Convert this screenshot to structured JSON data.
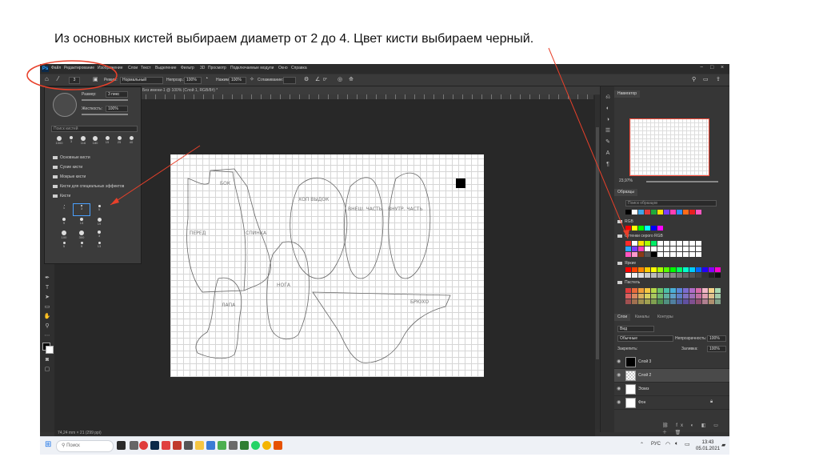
{
  "caption": "Из основных кистей выбираем диаметр от 2 до 4. Цвет кисти выбираем черный.",
  "ps": {
    "logo": "Ps",
    "menu": [
      "Файл",
      "Редактирование",
      "Изображение",
      "Слои",
      "Текст",
      "Выделение",
      "Фильтр",
      "3D",
      "Просмотр",
      "Подключаемые модули",
      "Окно",
      "Справка"
    ],
    "window_controls": {
      "minimize": "−",
      "maximize": "□",
      "close": "×"
    },
    "options": {
      "mode_label": "Режим:",
      "mode_value": "Нормальный",
      "opacity_label": "Непрозр.:",
      "opacity_value": "100%",
      "flow_label": "Нажим:",
      "flow_value": "100%",
      "smoothing_label": "Сглаживание:",
      "brush_size": "3",
      "angle": "0°"
    },
    "doc_tab": "Без имени-1 @ 100% (Слой 1, RGB/8#) *",
    "status": "74,24 mm × 21 (299 ppi)",
    "brush_popup": {
      "size_label": "Размер:",
      "size_value": "3 пикс",
      "hardness_label": "Жесткость:",
      "hardness_value": "100%",
      "search_placeholder": "Поиск кистей",
      "recent_sizes": [
        "1000",
        "3",
        "116",
        "180",
        "15",
        "25",
        "40"
      ],
      "folders": [
        "Основные кисти",
        "Сухие кисти",
        "Мокрые кисти",
        "Кисти для специальных эффектов",
        "Кисти"
      ],
      "tips": [
        "1",
        "3",
        "5",
        "9",
        "13",
        "19",
        "100",
        "300",
        "3",
        "5",
        "9",
        "13"
      ]
    },
    "right_panel": {
      "nav_tab": "Навигатор",
      "zoom": "23,97%",
      "swatches_tab": "Образцы",
      "swatches_search": "Поиск образцов",
      "swatch_groups": [
        "RGB",
        "Оттенки серого RGB",
        "Яркие",
        "Пастель"
      ],
      "layers_tabs": [
        "Слои",
        "Каналы",
        "Контуры"
      ],
      "kind_label": "Вид",
      "blend_mode": "Обычные",
      "opacity_label": "Непрозрачность:",
      "opacity_value": "100%",
      "lock_label": "Закрепить:",
      "fill_label": "Заливка:",
      "fill_value": "100%",
      "layers": [
        {
          "name": "Слой 3",
          "thumb": "#000000"
        },
        {
          "name": "Слой 2",
          "thumb": "#eaeaea"
        },
        {
          "name": "Эскиз",
          "thumb": "#ffffff"
        },
        {
          "name": "Фон",
          "thumb": "#ffffff"
        }
      ]
    }
  },
  "taskbar": {
    "search": "Поиск",
    "lang": "РУС",
    "time": "13:43",
    "date": "05.01.2021"
  },
  "colors": {
    "accent": "#ff4b3a",
    "callout": "#e8402a"
  }
}
